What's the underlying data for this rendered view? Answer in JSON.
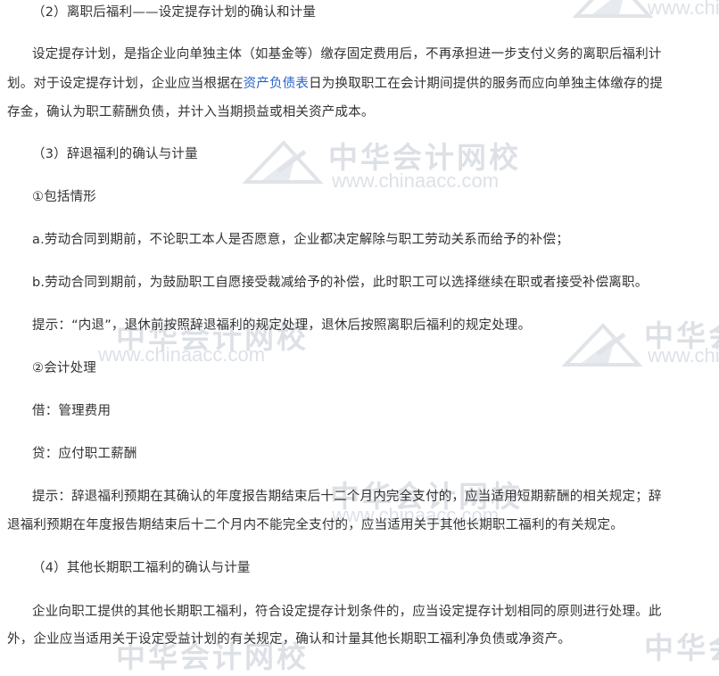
{
  "lines": [
    "（2）离职后福利——设定提存计划的确认和计量",
    "设定提存计划，是指企业向单独主体（如基金等）缴存固定费用后，不再承担进一步支付义务的离职后福利计",
    "存金，确认为职工薪酬负债，并计入当期损益或相关资产成本。",
    "（3）辞退福利的确认与计量",
    "①包括情形",
    "a.劳动合同到期前，不论职工本人是否愿意，企业都决定解除与职工劳动关系而给予的补偿；",
    "b.劳动合同到期前，为鼓励职工自愿接受裁减给予的补偿，此时职工可以选择继续在职或者接受补偿离职。",
    "提示：“内退”，退休前按照辞退福利的规定处理，退休后按照离职后福利的规定处理。",
    "②会计处理",
    "借：管理费用",
    "贷：应付职工薪酬",
    "提示：辞退福利预期在其确认的年度报告期结束后十二个月内完全支付的，应当适用短期薪酬的相关规定；辞",
    "退福利预期在年度报告期结束后十二个月内不能完全支付的，应当适用关于其他长期职工福利的有关规定。",
    "（4）其他长期职工福利的确认与计量",
    "企业向职工提供的其他长期职工福利，符合设定提存计划条件的，应当设定提存计划相同的原则进行处理。此",
    "外，企业应当适用关于设定受益计划的有关规定，确认和计量其他长期职工福利净负债或净资产。"
  ],
  "line3_before": "划。对于设定提存计划，企业应当根据在",
  "line3_link": "资产负债表",
  "line3_after": "日为换取职工在会计期间提供的服务而应向单独主体缴存的提",
  "watermark": {
    "cn": "中华会计网校",
    "cn_partial": "中华会",
    "en": "www.chinaacc.com",
    "en_partial": "www.chi"
  },
  "colors": {
    "text": "#333333",
    "link": "#2a63c9",
    "watermark": "#c2c9d3"
  }
}
